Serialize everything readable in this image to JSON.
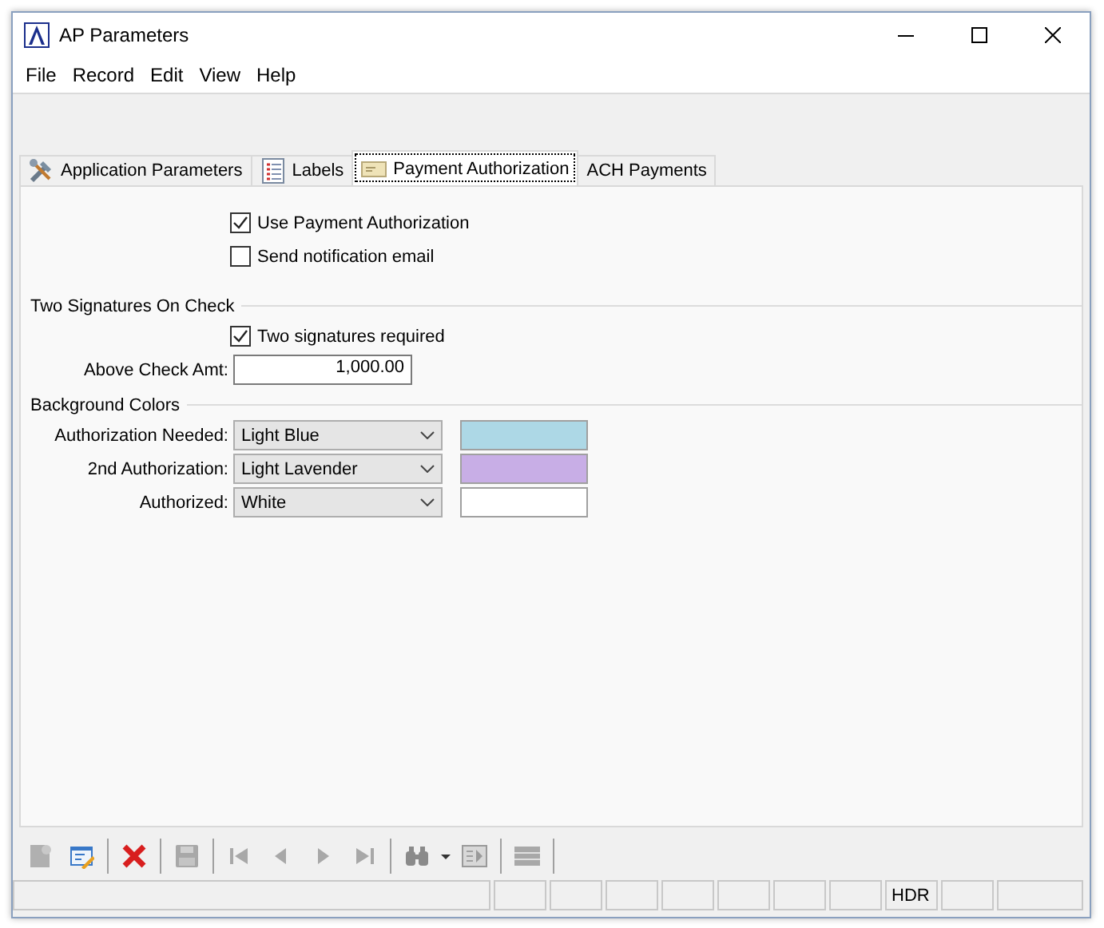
{
  "window": {
    "title": "AP Parameters"
  },
  "menu": [
    "File",
    "Record",
    "Edit",
    "View",
    "Help"
  ],
  "tabs": [
    {
      "label": "Application Parameters",
      "kind": "tools",
      "selected": false
    },
    {
      "label": "Labels",
      "kind": "list",
      "selected": false
    },
    {
      "label": "Payment Authorization",
      "kind": "card",
      "selected": true
    },
    {
      "label": "ACH Payments",
      "kind": "none",
      "selected": false
    }
  ],
  "options": [
    {
      "label": "Use Payment Authorization",
      "checked": true
    },
    {
      "label": "Send notification email",
      "checked": false
    }
  ],
  "two_signatures": {
    "title": "Two Signatures On Check",
    "option": {
      "label": "Two signatures required",
      "checked": true
    },
    "amount_label": "Above Check Amt:",
    "amount": "1,000.00"
  },
  "background_colors": {
    "title": "Background Colors",
    "rows": [
      {
        "label": "Authorization Needed:",
        "value": "Light Blue",
        "color": "#add8e6"
      },
      {
        "label": "2nd Authorization:",
        "value": "Light Lavender",
        "color": "#c8aee6"
      },
      {
        "label": "Authorized:",
        "value": "White",
        "color": "#ffffff"
      }
    ]
  },
  "toolbar": [
    {
      "kind": "new",
      "disabled": true
    },
    {
      "kind": "edit",
      "disabled": false
    },
    {
      "kind": "sep"
    },
    {
      "kind": "delete",
      "disabled": false
    },
    {
      "kind": "sep"
    },
    {
      "kind": "save",
      "disabled": true
    },
    {
      "kind": "sep"
    },
    {
      "kind": "first",
      "disabled": true
    },
    {
      "kind": "prev",
      "disabled": true
    },
    {
      "kind": "next",
      "disabled": true
    },
    {
      "kind": "last",
      "disabled": true
    },
    {
      "kind": "sep"
    },
    {
      "kind": "find",
      "disabled": true
    },
    {
      "kind": "caret",
      "disabled": false
    },
    {
      "kind": "export",
      "disabled": true
    },
    {
      "kind": "sep"
    },
    {
      "kind": "list",
      "disabled": true
    },
    {
      "kind": "sep"
    }
  ],
  "status_bar": {
    "label": "HDR"
  }
}
